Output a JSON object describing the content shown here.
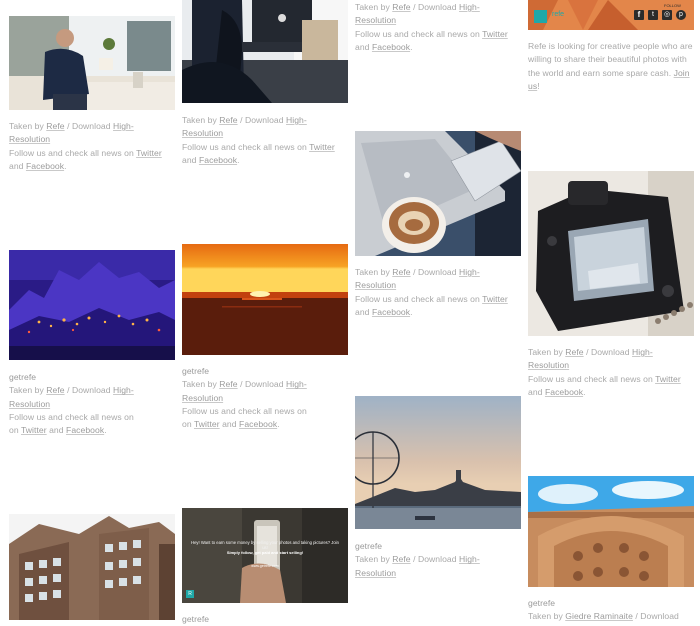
{
  "common": {
    "taken_by": "Taken by",
    "author": "Refe",
    "sep_download": "/ Download",
    "hires": "High-Resolution",
    "hires_a": "High-",
    "hires_b": "Resolution",
    "follow": "Follow us and check all news on",
    "twitter": "Twitter",
    "and": "and",
    "facebook": "Facebook",
    "period": "."
  },
  "promo": {
    "text": "Refe is looking for creative people who are willing to share their beautiful photos with the world and earn some spare cash.",
    "join": "Join",
    "us": "us",
    "bang": "!",
    "banner_brand": "refe",
    "banner_label": "FOLLOW"
  },
  "tags": {
    "getrefe": "getrefe"
  },
  "last_card": {
    "author": "Giedre Raminaite",
    "download": "/ Download"
  },
  "phone_ad": {
    "headline": "Hey! Want to earn some money by selling your photos and taking pictures? Join us!",
    "sub": "Simply follow, get paid and start selling!",
    "url": "www.getrefe.com",
    "badge": "R"
  },
  "colors": {
    "link": "#9c9c9c",
    "text": "#a9a9a9",
    "banner_teal": "#1fa8a8"
  }
}
